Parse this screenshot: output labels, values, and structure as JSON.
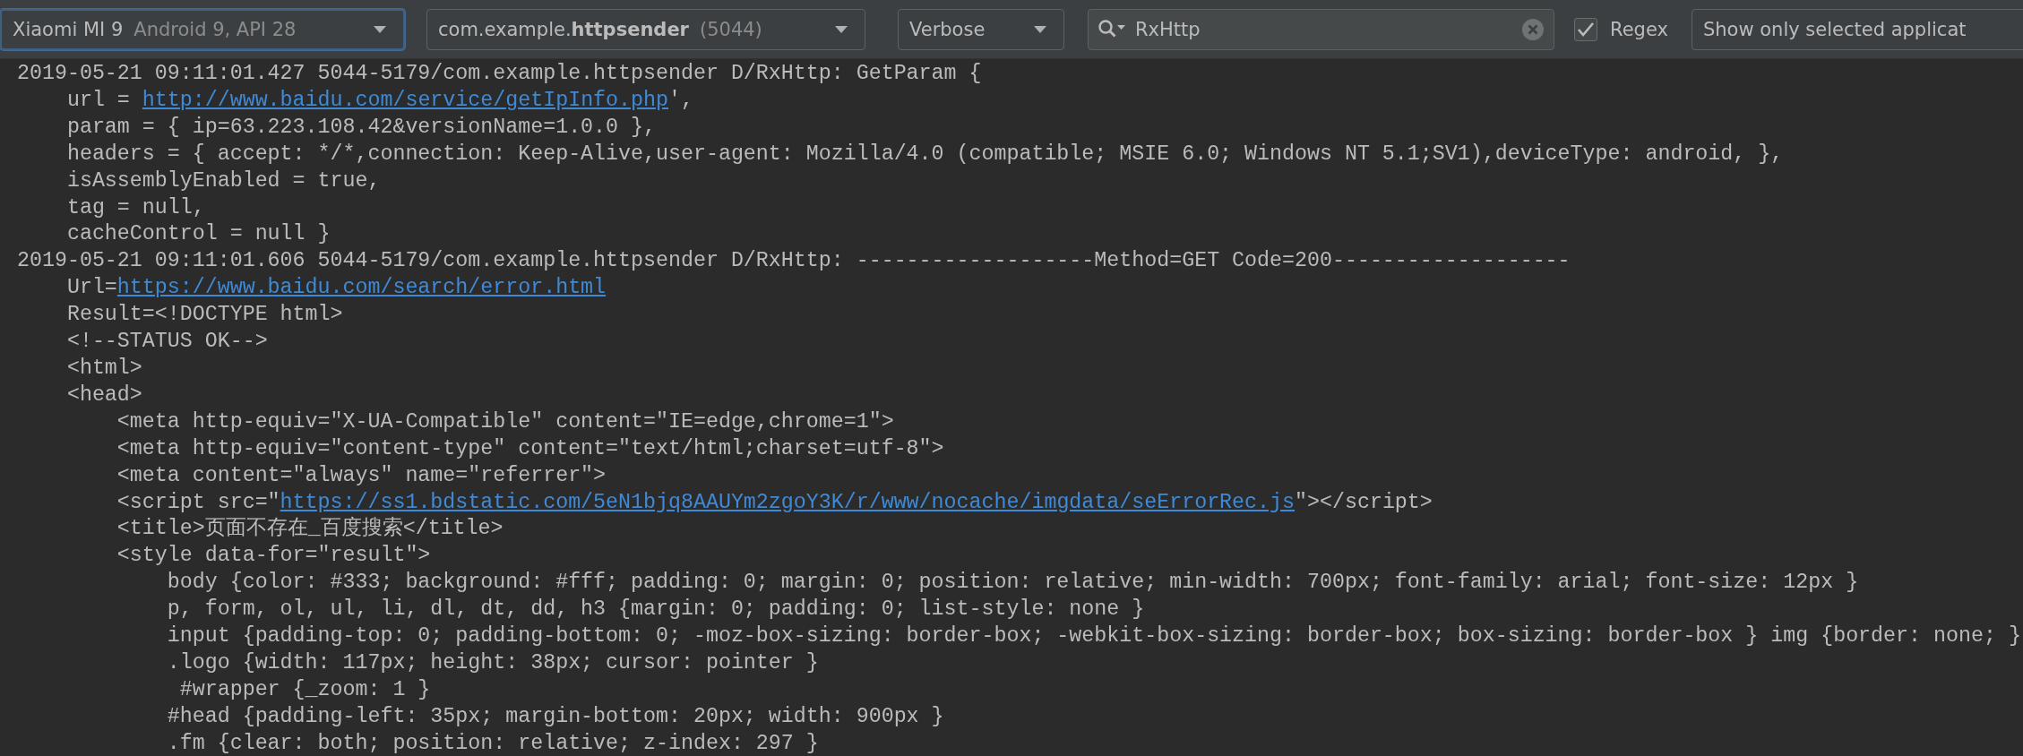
{
  "toolbar": {
    "device_combo": {
      "name": "Xiaomi MI 9",
      "detail": "Android 9, API 28",
      "focused": true
    },
    "process_combo": {
      "package": "com.example.**httpsender**",
      "pid": "(5044)",
      "focused": false
    },
    "level_combo": {
      "value": "Verbose",
      "focused": false
    },
    "search": {
      "value": "RxHttp"
    },
    "regex": {
      "label": "Regex",
      "checked": true
    },
    "filter_combo": {
      "value": "Show only selected applicat",
      "focused": false
    }
  },
  "log_lines": [
    {
      "text": "2019-05-21 09:11:01.427 5044-5179/com.example.httpsender D/RxHttp: GetParam {"
    },
    {
      "parts": [
        {
          "kind": "text",
          "text": "    url = "
        },
        {
          "kind": "link",
          "text": "http://www.baidu.com/service/getIpInfo.php"
        },
        {
          "kind": "text",
          "text": "',"
        }
      ]
    },
    {
      "text": "    param = { ip=63.223.108.42&versionName=1.0.0 },"
    },
    {
      "text": "    headers = { accept: */*,connection: Keep-Alive,user-agent: Mozilla/4.0 (compatible; MSIE 6.0; Windows NT 5.1;SV1),deviceType: android, },"
    },
    {
      "text": "    isAssemblyEnabled = true,"
    },
    {
      "text": "    tag = null,"
    },
    {
      "text": "    cacheControl = null }"
    },
    {
      "text": "2019-05-21 09:11:01.606 5044-5179/com.example.httpsender D/RxHttp: -------------------Method=GET Code=200-------------------"
    },
    {
      "parts": [
        {
          "kind": "text",
          "text": "    Url="
        },
        {
          "kind": "link",
          "text": "https://www.baidu.com/search/error.html"
        }
      ]
    },
    {
      "text": "    Result=<!DOCTYPE html>"
    },
    {
      "text": "    <!--STATUS OK-->"
    },
    {
      "text": "    <html>"
    },
    {
      "text": "    <head>"
    },
    {
      "text": "        <meta http-equiv=\"X-UA-Compatible\" content=\"IE=edge,chrome=1\">"
    },
    {
      "text": "        <meta http-equiv=\"content-type\" content=\"text/html;charset=utf-8\">"
    },
    {
      "text": "        <meta content=\"always\" name=\"referrer\">"
    },
    {
      "parts": [
        {
          "kind": "text",
          "text": "        <script src=\""
        },
        {
          "kind": "link",
          "text": "https://ss1.bdstatic.com/5eN1bjq8AAUYm2zgoY3K/r/www/nocache/imgdata/seErrorRec.js"
        },
        {
          "kind": "text",
          "text": "\"></script>"
        }
      ]
    },
    {
      "text": "        <title>页面不存在_百度搜索</title>"
    },
    {
      "text": "        <style data-for=\"result\">"
    },
    {
      "text": "            body {color: #333; background: #fff; padding: 0; margin: 0; position: relative; min-width: 700px; font-family: arial; font-size: 12px }"
    },
    {
      "text": "            p, form, ol, ul, li, dl, dt, dd, h3 {margin: 0; padding: 0; list-style: none }"
    },
    {
      "text": "            input {padding-top: 0; padding-bottom: 0; -moz-box-sizing: border-box; -webkit-box-sizing: border-box; box-sizing: border-box } img {border: none; }"
    },
    {
      "text": "            .logo {width: 117px; height: 38px; cursor: pointer }"
    },
    {
      "text": "             #wrapper {_zoom: 1 }"
    },
    {
      "text": "            #head {padding-left: 35px; margin-bottom: 20px; width: 900px }"
    },
    {
      "text": "            .fm {clear: both; position: relative; z-index: 297 }"
    }
  ]
}
